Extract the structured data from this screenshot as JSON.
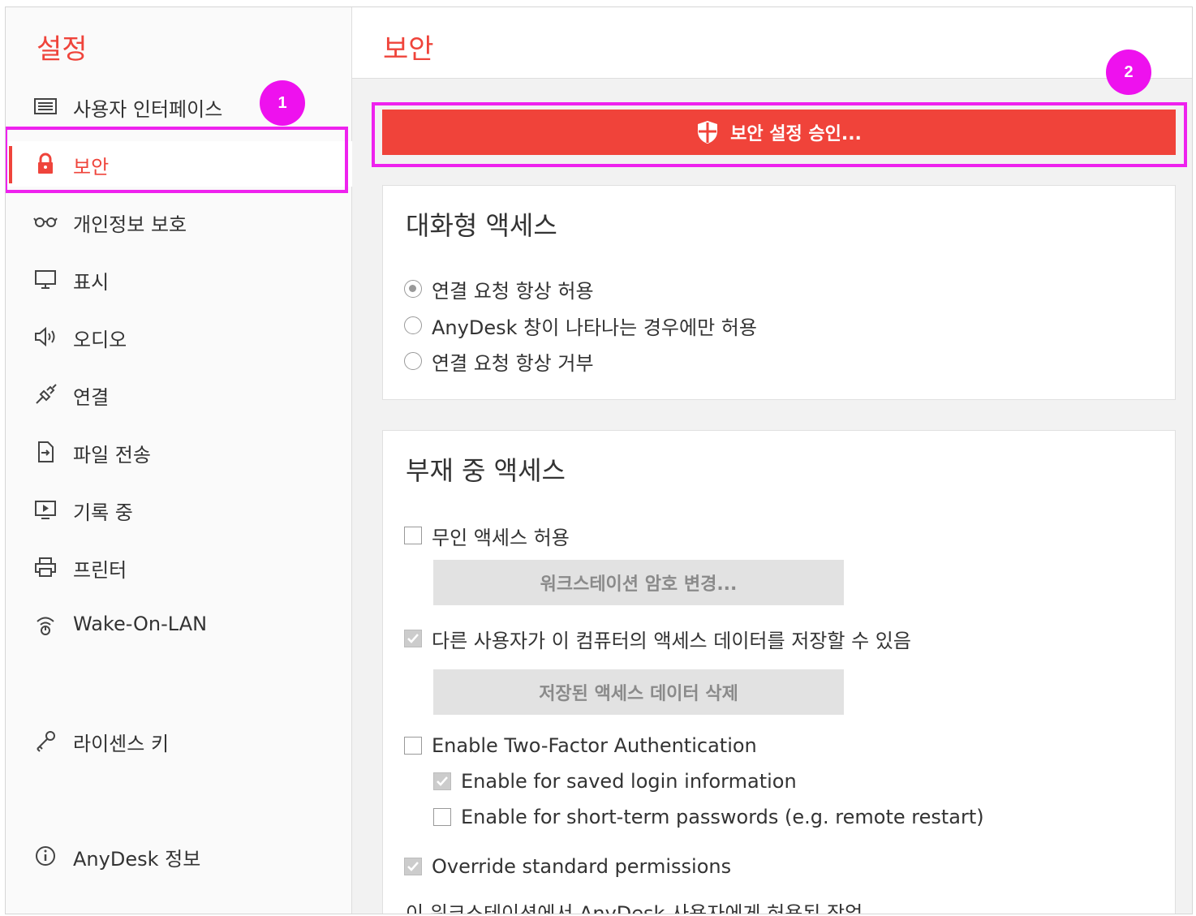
{
  "sidebar": {
    "title": "설정",
    "items": [
      {
        "label": "사용자 인터페이스",
        "icon": "user-interface-icon"
      },
      {
        "label": "보안",
        "icon": "lock-icon",
        "active": true
      },
      {
        "label": "개인정보 보호",
        "icon": "glasses-icon"
      },
      {
        "label": "표시",
        "icon": "monitor-icon"
      },
      {
        "label": "오디오",
        "icon": "speaker-icon"
      },
      {
        "label": "연결",
        "icon": "connection-icon"
      },
      {
        "label": "파일 전송",
        "icon": "file-transfer-icon"
      },
      {
        "label": "기록 중",
        "icon": "recording-icon"
      },
      {
        "label": "프린터",
        "icon": "printer-icon"
      },
      {
        "label": "Wake-On-LAN",
        "icon": "wake-on-lan-icon"
      },
      {
        "label": "라이센스 키",
        "icon": "key-icon"
      },
      {
        "label": "AnyDesk 정보",
        "icon": "info-icon"
      }
    ]
  },
  "main": {
    "title": "보안",
    "unlock_button": "보안 설정 승인...",
    "interactive_access": {
      "title": "대화형 액세스",
      "options": [
        {
          "label": "연결 요청 항상 허용",
          "selected": true
        },
        {
          "label": "AnyDesk 창이 나타나는 경우에만 허용",
          "selected": false
        },
        {
          "label": "연결 요청 항상 거부",
          "selected": false
        }
      ]
    },
    "unattended_access": {
      "title": "부재 중 액세스",
      "allow_unattended": {
        "label": "무인 액세스 허용",
        "checked": false
      },
      "change_password_button": "워크스테이션 암호 변경...",
      "allow_save_access_data": {
        "label": "다른 사용자가 이 컴퓨터의 액세스 데이터를 저장할 수 있음",
        "checked": true
      },
      "delete_saved_button": "저장된 액세스 데이터 삭제",
      "two_factor": {
        "label": "Enable Two-Factor Authentication",
        "checked": false
      },
      "saved_login": {
        "label": "Enable for saved login information",
        "checked": true
      },
      "short_term": {
        "label": "Enable for short-term passwords (e.g. remote restart)",
        "checked": false
      },
      "override_permissions": {
        "label": "Override standard permissions",
        "checked": true
      },
      "permissions_caption": "이 워크스테이션에서 AnyDesk 사용자에게 허용된 작업"
    }
  },
  "annotations": {
    "badge1": "1",
    "badge2": "2"
  },
  "colors": {
    "accent": "#ef443b",
    "callout": "#ee22ee",
    "button_gray": "#e2e2e2"
  }
}
